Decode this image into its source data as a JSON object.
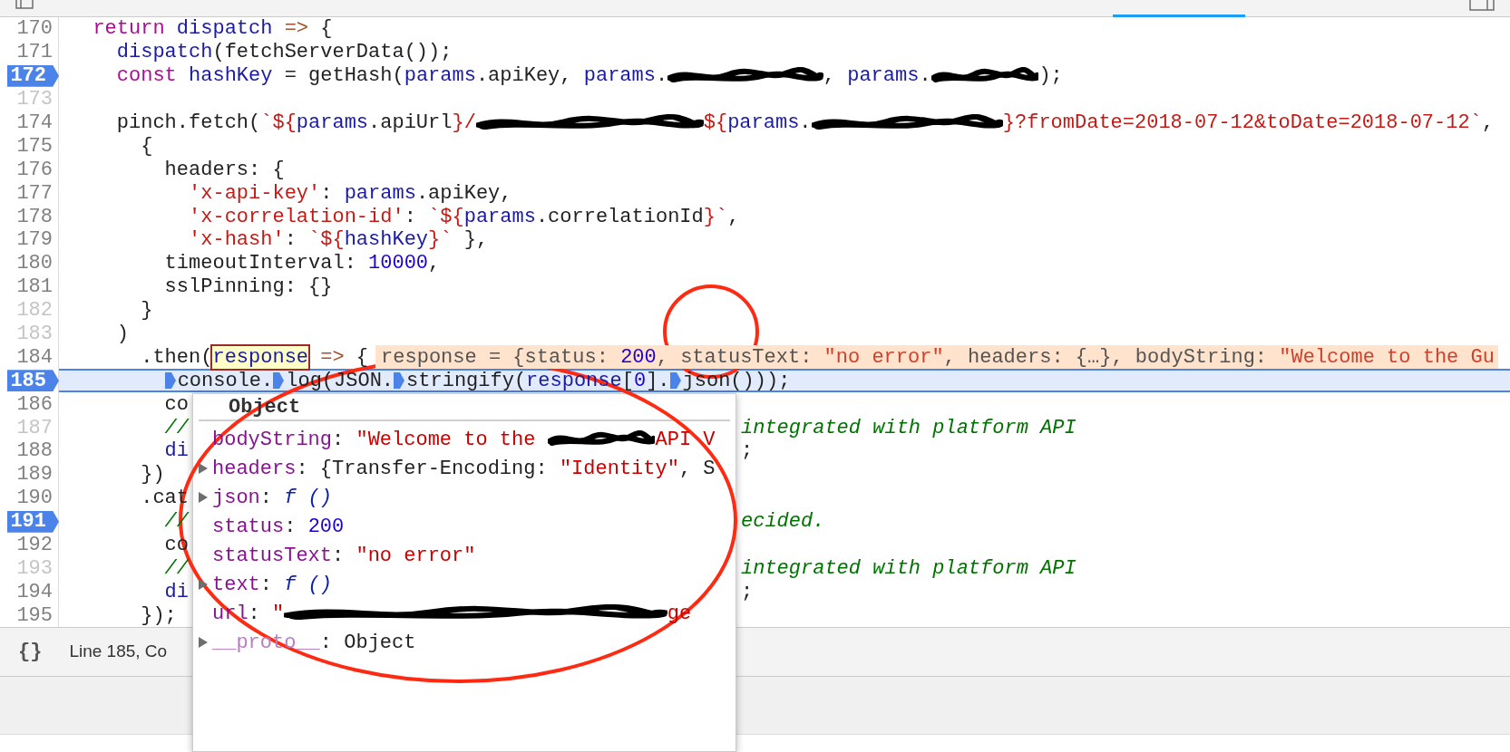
{
  "editor": {
    "lines": [
      {
        "number": "170",
        "breakpoint": false,
        "dimmed": false,
        "current": false,
        "segments": [
          {
            "kind": "keyword",
            "text": "  return"
          },
          {
            "kind": "variable",
            "text": " dispatch"
          },
          {
            "kind": "operator",
            "text": " =>"
          },
          {
            "kind": "plain",
            "text": " {"
          }
        ]
      },
      {
        "number": "171",
        "breakpoint": false,
        "dimmed": false,
        "current": false,
        "segments": [
          {
            "kind": "variable",
            "text": "    dispatch"
          },
          {
            "kind": "plain",
            "text": "(fetchServerData());"
          }
        ]
      },
      {
        "number": "172",
        "breakpoint": true,
        "dimmed": false,
        "current": false,
        "segments": [
          {
            "kind": "keyword",
            "text": "    const"
          },
          {
            "kind": "variable",
            "text": " hashKey"
          },
          {
            "kind": "plain",
            "text": " = getHash("
          },
          {
            "kind": "variable",
            "text": "params"
          },
          {
            "kind": "plain",
            "text": ".apiKey, "
          },
          {
            "kind": "variable",
            "text": "params"
          },
          {
            "kind": "plain",
            "text": "."
          },
          {
            "kind": "redaction"
          },
          {
            "kind": "plain",
            "text": ", "
          },
          {
            "kind": "variable",
            "text": "params"
          },
          {
            "kind": "plain",
            "text": "."
          },
          {
            "kind": "redaction"
          },
          {
            "kind": "plain",
            "text": ");"
          }
        ]
      },
      {
        "number": "173",
        "breakpoint": false,
        "dimmed": true,
        "current": false
      },
      {
        "number": "174",
        "breakpoint": false,
        "dimmed": false,
        "current": false,
        "segments": [
          {
            "kind": "plain",
            "text": "    pinch.fetch("
          },
          {
            "kind": "string",
            "text": "`${"
          },
          {
            "kind": "variable",
            "text": "params"
          },
          {
            "kind": "plain",
            "text": ".apiUrl"
          },
          {
            "kind": "string",
            "text": "}/"
          },
          {
            "kind": "redaction"
          },
          {
            "kind": "string",
            "text": "${"
          },
          {
            "kind": "variable",
            "text": "params"
          },
          {
            "kind": "plain",
            "text": "."
          },
          {
            "kind": "redaction"
          },
          {
            "kind": "string",
            "text": "}?fromDate=2018-07-12&toDate=2018-07-12`"
          },
          {
            "kind": "plain",
            "text": ","
          }
        ]
      },
      {
        "number": "175",
        "breakpoint": false,
        "dimmed": false,
        "current": false,
        "segments": [
          {
            "kind": "plain",
            "text": "      {"
          }
        ]
      },
      {
        "number": "176",
        "breakpoint": false,
        "dimmed": false,
        "current": false,
        "segments": [
          {
            "kind": "plain",
            "text": "        headers: {"
          }
        ]
      },
      {
        "number": "177",
        "breakpoint": false,
        "dimmed": false,
        "current": false,
        "segments": [
          {
            "kind": "string",
            "text": "          'x-api-key'"
          },
          {
            "kind": "plain",
            "text": ": "
          },
          {
            "kind": "variable",
            "text": "params"
          },
          {
            "kind": "plain",
            "text": ".apiKey,"
          }
        ]
      },
      {
        "number": "178",
        "breakpoint": false,
        "dimmed": false,
        "current": false,
        "segments": [
          {
            "kind": "string",
            "text": "          'x-correlation-id'"
          },
          {
            "kind": "plain",
            "text": ": "
          },
          {
            "kind": "string",
            "text": "`${"
          },
          {
            "kind": "variable",
            "text": "params"
          },
          {
            "kind": "plain",
            "text": ".correlationId"
          },
          {
            "kind": "string",
            "text": "}`"
          },
          {
            "kind": "plain",
            "text": ","
          }
        ]
      },
      {
        "number": "179",
        "breakpoint": false,
        "dimmed": false,
        "current": false,
        "segments": [
          {
            "kind": "string",
            "text": "          'x-hash'"
          },
          {
            "kind": "plain",
            "text": ": "
          },
          {
            "kind": "string",
            "text": "`${"
          },
          {
            "kind": "variable",
            "text": "hashKey"
          },
          {
            "kind": "string",
            "text": "}`"
          },
          {
            "kind": "plain",
            "text": " },"
          }
        ]
      },
      {
        "number": "180",
        "breakpoint": false,
        "dimmed": false,
        "current": false,
        "segments": [
          {
            "kind": "plain",
            "text": "        timeoutInterval: "
          },
          {
            "kind": "number",
            "text": "10000"
          },
          {
            "kind": "plain",
            "text": ","
          }
        ]
      },
      {
        "number": "181",
        "breakpoint": false,
        "dimmed": false,
        "current": false,
        "segments": [
          {
            "kind": "plain",
            "text": "        sslPinning: {}"
          }
        ]
      },
      {
        "number": "182",
        "breakpoint": false,
        "dimmed": true,
        "current": false,
        "segments": [
          {
            "kind": "plain",
            "text": "      }"
          }
        ]
      },
      {
        "number": "183",
        "breakpoint": false,
        "dimmed": true,
        "current": false,
        "segments": [
          {
            "kind": "plain",
            "text": "    )"
          }
        ]
      },
      {
        "number": "184",
        "breakpoint": false,
        "dimmed": false,
        "current": false,
        "segments": [
          {
            "kind": "plain",
            "text": "      .then("
          },
          {
            "kind": "hovered",
            "text": "response"
          },
          {
            "kind": "operator",
            "text": " =>"
          },
          {
            "kind": "plain",
            "text": " {"
          }
        ],
        "inline_value": [
          {
            "kind": "plain",
            "text": "response = {status: "
          },
          {
            "kind": "number",
            "text": "200"
          },
          {
            "kind": "plain",
            "text": ", statusText: "
          },
          {
            "kind": "string",
            "text": "\"no error\""
          },
          {
            "kind": "plain",
            "text": ", headers: {…}, bodyString: "
          },
          {
            "kind": "string",
            "text": "\"Welcome to the Gu"
          }
        ]
      },
      {
        "number": "185",
        "breakpoint": true,
        "dimmed": false,
        "current": true,
        "segments": [
          {
            "kind": "inline-breakpoint"
          },
          {
            "kind": "plain",
            "text": "        console."
          },
          {
            "kind": "inline-breakpoint"
          },
          {
            "kind": "plain",
            "text": "log(JSON."
          },
          {
            "kind": "inline-breakpoint"
          },
          {
            "kind": "plain",
            "text": "stringify("
          },
          {
            "kind": "variable",
            "text": "response"
          },
          {
            "kind": "plain",
            "text": "["
          },
          {
            "kind": "number",
            "text": "0"
          },
          {
            "kind": "plain",
            "text": "]."
          },
          {
            "kind": "inline-breakpoint"
          },
          {
            "kind": "plain",
            "text": "json()));"
          }
        ]
      },
      {
        "number": "186",
        "breakpoint": false,
        "dimmed": false,
        "current": false,
        "segments": [
          {
            "kind": "plain",
            "text": "        co"
          }
        ]
      },
      {
        "number": "187",
        "breakpoint": false,
        "dimmed": true,
        "current": false,
        "segments": [
          {
            "kind": "comment",
            "text": "        //"
          }
        ],
        "right_segments": [
          {
            "kind": "comment",
            "text": "integrated with platform API"
          }
        ]
      },
      {
        "number": "188",
        "breakpoint": false,
        "dimmed": false,
        "current": false,
        "segments": [
          {
            "kind": "variable",
            "text": "        di"
          }
        ],
        "right_segments": [
          {
            "kind": "plain",
            "text": ";"
          }
        ]
      },
      {
        "number": "189",
        "breakpoint": false,
        "dimmed": false,
        "current": false,
        "segments": [
          {
            "kind": "plain",
            "text": "      })"
          }
        ]
      },
      {
        "number": "190",
        "breakpoint": false,
        "dimmed": false,
        "current": false,
        "segments": [
          {
            "kind": "plain",
            "text": "      .cat"
          }
        ]
      },
      {
        "number": "191",
        "breakpoint": true,
        "dimmed": false,
        "current": false,
        "segments": [
          {
            "kind": "comment",
            "text": "        //"
          }
        ],
        "right_segments": [
          {
            "kind": "comment",
            "text": "ecided."
          }
        ]
      },
      {
        "number": "192",
        "breakpoint": false,
        "dimmed": false,
        "current": false,
        "segments": [
          {
            "kind": "plain",
            "text": "        co"
          }
        ]
      },
      {
        "number": "193",
        "breakpoint": false,
        "dimmed": true,
        "current": false,
        "segments": [
          {
            "kind": "comment",
            "text": "        //"
          }
        ],
        "right_segments": [
          {
            "kind": "comment",
            "text": "integrated with platform API"
          }
        ]
      },
      {
        "number": "194",
        "breakpoint": false,
        "dimmed": false,
        "current": false,
        "segments": [
          {
            "kind": "variable",
            "text": "        di"
          }
        ],
        "right_segments": [
          {
            "kind": "plain",
            "text": ";"
          }
        ]
      },
      {
        "number": "195",
        "breakpoint": false,
        "dimmed": false,
        "current": false,
        "segments": [
          {
            "kind": "plain",
            "text": "      });"
          }
        ]
      }
    ]
  },
  "popup": {
    "title": "Object",
    "properties": [
      {
        "expandable": false,
        "internal": false,
        "key": "bodyString",
        "value": [
          {
            "kind": "plain",
            "text": ": "
          },
          {
            "kind": "string",
            "text": "\"Welcome to the "
          },
          {
            "kind": "redaction"
          },
          {
            "kind": "string",
            "text": "API V"
          }
        ]
      },
      {
        "expandable": true,
        "internal": false,
        "key": "headers",
        "value": [
          {
            "kind": "plain",
            "text": ": {Transfer-Encoding: "
          },
          {
            "kind": "string",
            "text": "\"Identity\""
          },
          {
            "kind": "plain",
            "text": ", S"
          }
        ]
      },
      {
        "expandable": true,
        "internal": false,
        "key": "json",
        "value": [
          {
            "kind": "plain",
            "text": ": "
          },
          {
            "kind": "function",
            "text": "f ()"
          }
        ]
      },
      {
        "expandable": false,
        "internal": false,
        "key": "status",
        "value": [
          {
            "kind": "plain",
            "text": ": "
          },
          {
            "kind": "number",
            "text": "200"
          }
        ]
      },
      {
        "expandable": false,
        "internal": false,
        "key": "statusText",
        "value": [
          {
            "kind": "plain",
            "text": ": "
          },
          {
            "kind": "string",
            "text": "\"no error\""
          }
        ]
      },
      {
        "expandable": true,
        "internal": false,
        "key": "text",
        "value": [
          {
            "kind": "plain",
            "text": ": "
          },
          {
            "kind": "function",
            "text": "f ()"
          }
        ]
      },
      {
        "expandable": false,
        "internal": false,
        "key": "url",
        "value": [
          {
            "kind": "plain",
            "text": ": "
          },
          {
            "kind": "string",
            "text": "\""
          },
          {
            "kind": "redaction"
          },
          {
            "kind": "string",
            "text": "ge"
          }
        ]
      },
      {
        "expandable": true,
        "internal": true,
        "key": "__proto__",
        "value": [
          {
            "kind": "plain",
            "text": ": Object"
          }
        ]
      }
    ]
  },
  "status_bar": {
    "format_button": "{}",
    "position": "Line 185, Co"
  }
}
